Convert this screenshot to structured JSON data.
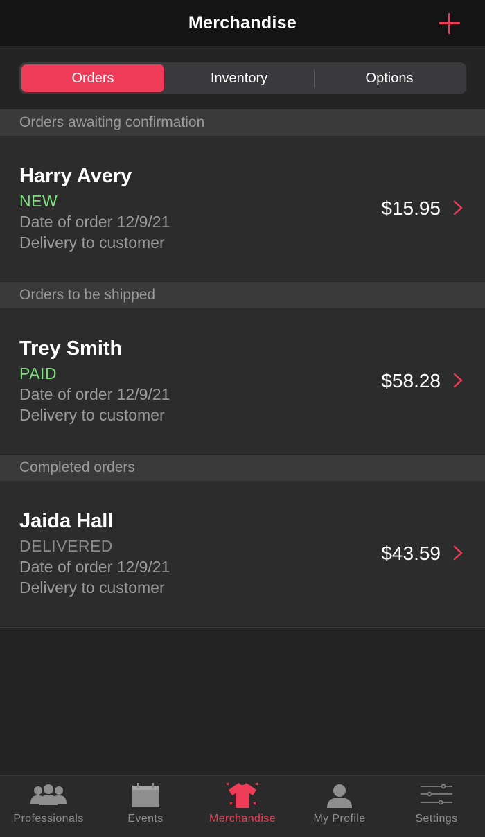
{
  "header": {
    "title": "Merchandise",
    "add_icon": "plus-icon",
    "accent": "#ee3b57"
  },
  "segments": [
    {
      "label": "Orders",
      "active": true
    },
    {
      "label": "Inventory",
      "active": false
    },
    {
      "label": "Options",
      "active": false
    }
  ],
  "sections": [
    {
      "title": "Orders awaiting confirmation",
      "order": {
        "name": "Harry Avery",
        "status": "NEW",
        "status_color": "#7ddf7d",
        "date": "Date of order 12/9/21",
        "delivery": "Delivery to customer",
        "price": "$15.95"
      }
    },
    {
      "title": "Orders to be shipped",
      "order": {
        "name": "Trey Smith",
        "status": "PAID",
        "status_color": "#7ddf7d",
        "date": "Date of order 12/9/21",
        "delivery": "Delivery to customer",
        "price": "$58.28"
      }
    },
    {
      "title": "Completed orders",
      "order": {
        "name": "Jaida Hall",
        "status": "DELIVERED",
        "status_color": "#8a8a8a",
        "date": "Date of order 12/9/21",
        "delivery": "Delivery to customer",
        "price": "$43.59"
      }
    }
  ],
  "tabbar": {
    "items": [
      {
        "label": "Professionals",
        "icon": "people-group-icon",
        "active": false
      },
      {
        "label": "Events",
        "icon": "calendar-icon",
        "active": false
      },
      {
        "label": "Merchandise",
        "icon": "tshirt-icon",
        "active": true
      },
      {
        "label": "My Profile",
        "icon": "person-icon",
        "active": false
      },
      {
        "label": "Settings",
        "icon": "sliders-icon",
        "active": false
      }
    ]
  }
}
